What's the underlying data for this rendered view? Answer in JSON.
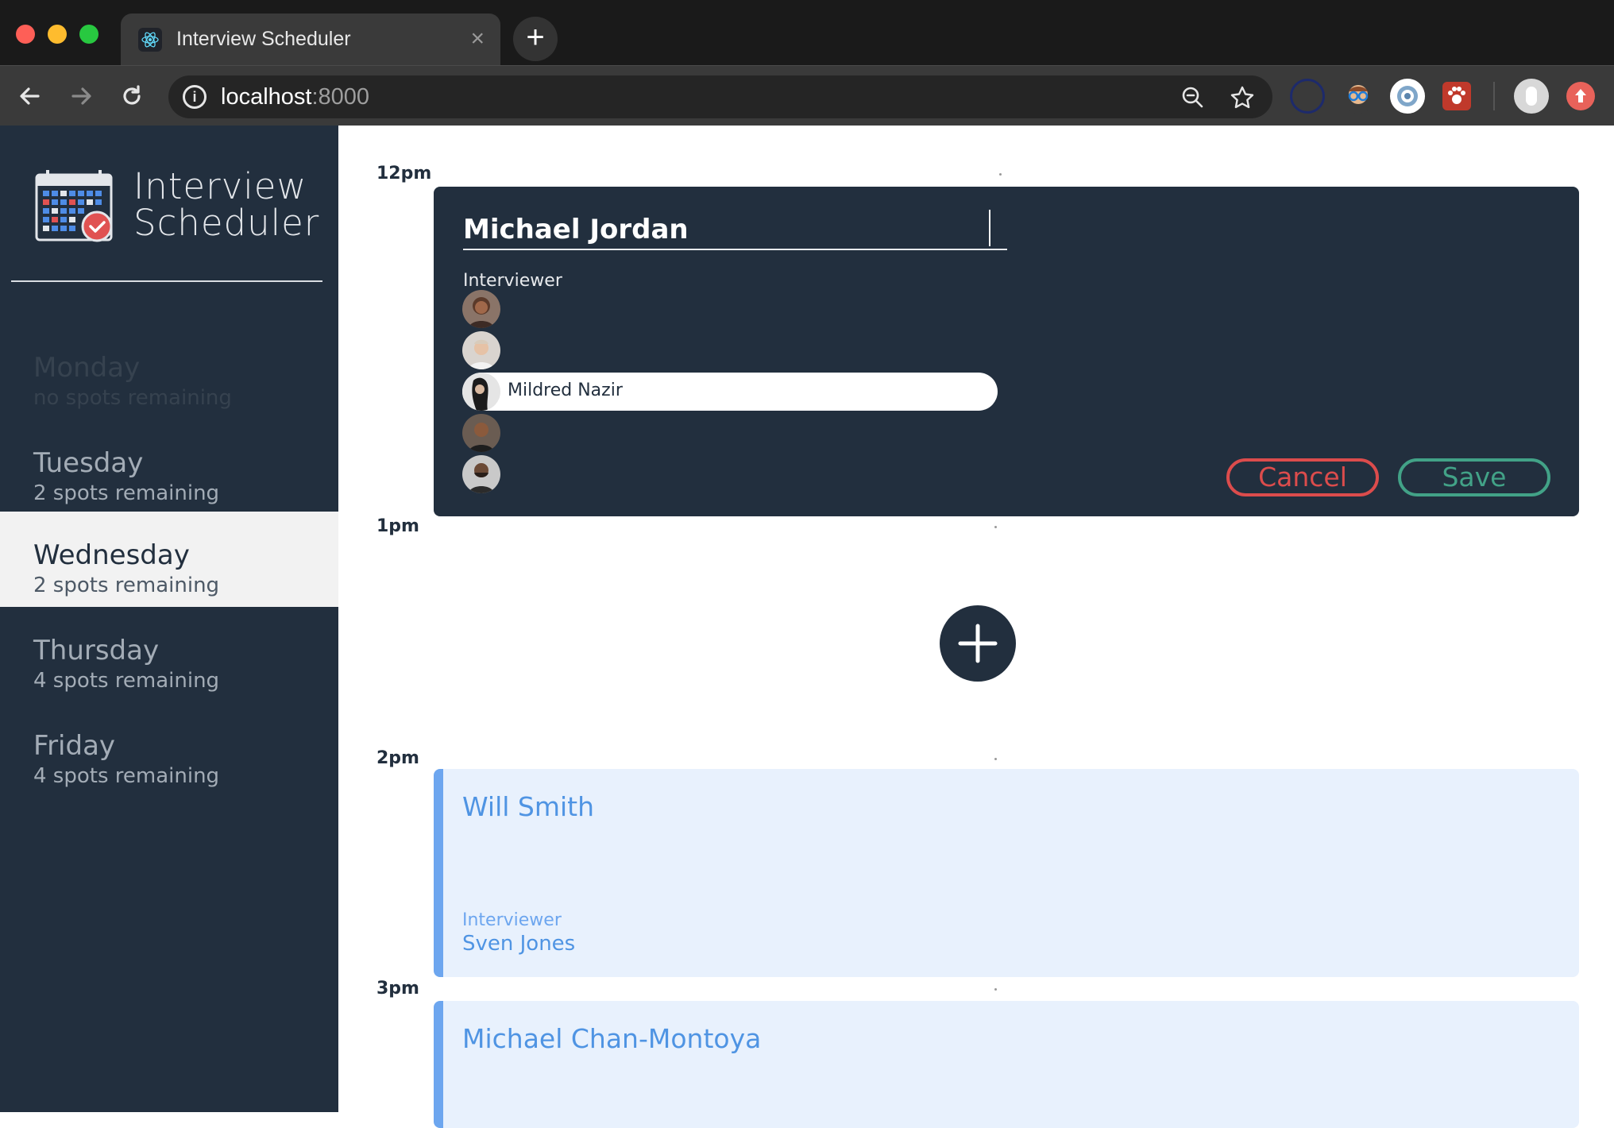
{
  "browser": {
    "tab_title": "Interview Scheduler",
    "tab_close": "×",
    "new_tab": "+",
    "url_host": "localhost",
    "url_port": ":8000"
  },
  "sidebar": {
    "logo_line1": "Interview",
    "logo_line2": "Scheduler",
    "days": [
      {
        "name": "Monday",
        "spots": "no spots remaining",
        "state": "full"
      },
      {
        "name": "Tuesday",
        "spots": "2 spots remaining",
        "state": "normal"
      },
      {
        "name": "Wednesday",
        "spots": "2 spots remaining",
        "state": "selected"
      },
      {
        "name": "Thursday",
        "spots": "4 spots remaining",
        "state": "normal"
      },
      {
        "name": "Friday",
        "spots": "4 spots remaining",
        "state": "normal"
      }
    ]
  },
  "schedule": {
    "times": [
      "12pm",
      "1pm",
      "2pm",
      "3pm"
    ],
    "form": {
      "student_name": "Michael Jordan",
      "interviewer_heading": "Interviewer",
      "selected_interviewer": "Mildred Nazir",
      "cancel_label": "Cancel",
      "save_label": "Save"
    },
    "appointments": [
      {
        "student": "Will Smith",
        "interviewer_label": "Interviewer",
        "interviewer": "Sven Jones"
      },
      {
        "student": "Michael Chan-Montoya"
      }
    ]
  },
  "colors": {
    "sidebar_bg": "#222f3e",
    "selected_day_bg": "#f2f2f2",
    "cancel": "#dc4c4c",
    "save": "#42a287",
    "appointment_bg": "#e8f1fd",
    "appointment_accent": "#6da6ef"
  }
}
